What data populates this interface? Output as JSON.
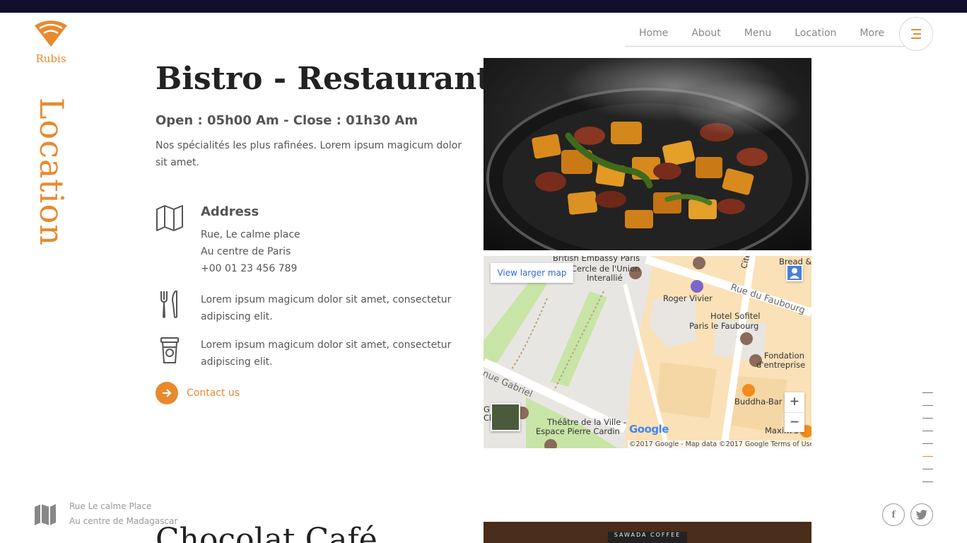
{
  "brand": {
    "name": "Rubis",
    "accent": "#e8892e",
    "topbar": "#120f2d"
  },
  "section_label": "Location",
  "nav": {
    "items": [
      "Home",
      "About",
      "Menu",
      "Location",
      "More"
    ]
  },
  "main": {
    "title": "Bistro - Restaurant",
    "hours": "Open : 05h00 Am - Close : 01h30 Am",
    "intro": "Nos spécialités les plus rafinées. Lorem ipsum magicum dolor sit amet.",
    "address": {
      "title": "Address",
      "line1": "Rue, Le calme place",
      "line2": "Au centre de Paris",
      "phone": "+00 01 23 456 789"
    },
    "feature_cutlery": "Lorem ipsum magicum dolor sit amet, consectetur adipiscing elit.",
    "feature_coffee": "Lorem ipsum magicum dolor sit amet, consectetur adipiscing elit.",
    "contact_label": "Contact us"
  },
  "map": {
    "view_larger": "View larger map",
    "labels": {
      "british": "British Embassy Paris",
      "cercle": "Cercle de l'Union",
      "interallie": "Interallié",
      "bread": "Bread &",
      "cite": "Cité du",
      "rue_faubourg": "Rue du Faubourg",
      "roger": "Roger Vivier",
      "sofitel1": "Hotel Sofitel",
      "sofitel2": "Paris le Faubourg",
      "fondation1": "Fondation",
      "fondation2": "d'entreprise",
      "gabriel": "nue Gabriel",
      "buddha": "Buddha-Bar",
      "theatre1": "Théâtre de la Ville -",
      "theatre2": "Espace Pierre Cardin",
      "maxims": "Maxim's",
      "gc": "G",
      "gc2": "Cl"
    },
    "zoom_in": "+",
    "zoom_out": "−",
    "google": "Google",
    "copyright": "©2017 Google - Map data ©2017 Google",
    "terms": "Terms of Use"
  },
  "footer": {
    "line1": "Rue Le calme Place",
    "line2": "Au centre de Madagascar",
    "facebook": "f"
  },
  "next": {
    "title": "Chocolat Café",
    "sign": "SAWADA COFFEE"
  },
  "page_dots": {
    "count": 8,
    "active_index": 5
  },
  "icons": [
    "wifi-logo-icon",
    "menu-icon",
    "map-icon",
    "cutlery-icon",
    "coffee-cup-icon",
    "arrow-right-icon",
    "facebook-icon",
    "twitter-icon"
  ]
}
